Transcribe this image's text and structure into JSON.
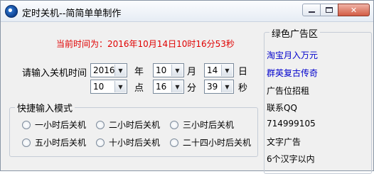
{
  "window": {
    "title": "定时关机--简简单单制作"
  },
  "current_time": "当前时间为：2016年10月14日10时16分53秒",
  "shutdown": {
    "label": "请输入关机时间",
    "year": "2016",
    "year_unit": "年",
    "month": "10",
    "month_unit": "月",
    "day": "14",
    "day_unit": "日",
    "hour": "10",
    "hour_unit": "点",
    "minute": "16",
    "minute_unit": "分",
    "second": "39",
    "second_unit": "秒"
  },
  "quick": {
    "title": "快捷输入模式",
    "options": [
      "一小时后关机",
      "二小时后关机",
      "三小时后关机",
      "五小时后关机",
      "十小时后关机",
      "二十四小时后关机"
    ]
  },
  "ads": {
    "title": "绿色广告区",
    "items": [
      "淘宝月入万元",
      "群英复古传奇",
      "广告位招租",
      "联系QQ",
      "714999105",
      "文字广告",
      "6个汉字以内"
    ]
  },
  "colors": {
    "time_text": "#e00000",
    "link": "#0000cc"
  }
}
